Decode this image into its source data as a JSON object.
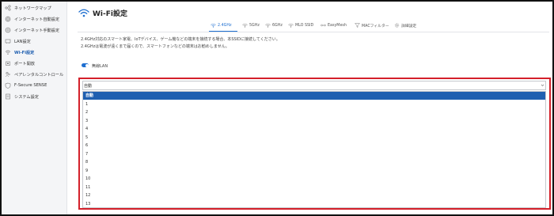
{
  "sidebar": {
    "items": [
      {
        "label": "ネットワークマップ",
        "icon": "network-map-icon",
        "active": false
      },
      {
        "label": "インターネット自動設定",
        "icon": "internet-auto-icon",
        "active": false
      },
      {
        "label": "インターネット手動設定",
        "icon": "internet-manual-icon",
        "active": false
      },
      {
        "label": "LAN設定",
        "icon": "lan-icon",
        "active": false
      },
      {
        "label": "Wi-Fi設定",
        "icon": "wifi-icon",
        "active": true
      },
      {
        "label": "ポート開放",
        "icon": "port-icon",
        "active": false
      },
      {
        "label": "ペアレンタルコントロール",
        "icon": "parental-icon",
        "active": false
      },
      {
        "label": "F-Secure SENSE",
        "icon": "fsecure-icon",
        "active": false
      },
      {
        "label": "システム設定",
        "icon": "system-icon",
        "active": false
      }
    ]
  },
  "header": {
    "title": "Wi-Fi設定"
  },
  "tabs": [
    {
      "label": "2.4GHz",
      "icon": "wifi-icon",
      "active": true
    },
    {
      "label": "5GHz",
      "icon": "wifi-icon",
      "active": false
    },
    {
      "label": "6GHz",
      "icon": "wifi-icon",
      "active": false
    },
    {
      "label": "MLO SSID",
      "icon": "wifi-icon",
      "active": false
    },
    {
      "label": "EasyMesh",
      "icon": "mesh-icon",
      "active": false
    },
    {
      "label": "MACフィルター",
      "icon": "filter-icon",
      "active": false
    },
    {
      "label": "詳細設定",
      "icon": "settings-icon",
      "active": false
    }
  ],
  "description": [
    "2.4GHz対応のスマート家電、IoTデバイス、ゲーム機などの端末を接続する場合、本SSIDに接続してください。",
    "2.4GHzは電波が遠くまで届くので、スマートフォンなどの端末はお勧めしません。"
  ],
  "toggle": {
    "label": "無線LAN",
    "on": true
  },
  "channel_select": {
    "value": "自動",
    "options": [
      "自動",
      "1",
      "2",
      "3",
      "4",
      "5",
      "6",
      "7",
      "8",
      "9",
      "10",
      "11",
      "12",
      "13"
    ],
    "selected_index": 0
  },
  "colors": {
    "accent": "#1f6fd0",
    "highlight": "#d4202a",
    "selected_bg": "#1f5fb0"
  }
}
